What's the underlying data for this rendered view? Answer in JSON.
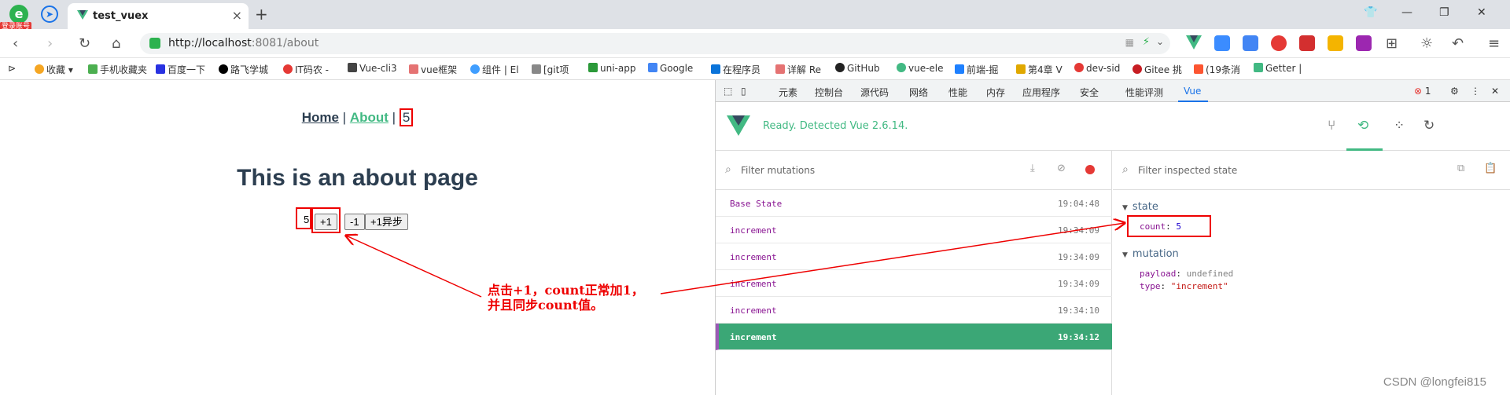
{
  "browser": {
    "login_badge": "登录账号",
    "tab_title": "test_vuex",
    "url_host": "http://localhost",
    "url_rest": ":8081/about"
  },
  "bookmarks": [
    {
      "label": "收藏",
      "color": "#f5a623"
    },
    {
      "label": "手机收藏夹",
      "color": "#4caf50"
    },
    {
      "label": "百度一下",
      "color": "#2932e1"
    },
    {
      "label": "路飞学城",
      "color": "#000000"
    },
    {
      "label": "IT码农 -",
      "color": "#e53935"
    },
    {
      "label": "Vue-cli3",
      "color": "#444444"
    },
    {
      "label": "vue框架",
      "color": "#e57373"
    },
    {
      "label": "组件 | El",
      "color": "#409eff"
    },
    {
      "label": "[git项",
      "color": "#888888"
    },
    {
      "label": "uni-app",
      "color": "#2b9939"
    },
    {
      "label": "Google",
      "color": "#4285f4"
    },
    {
      "label": "在程序员",
      "color": "#0a74da"
    },
    {
      "label": "详解 Re",
      "color": "#e57373"
    },
    {
      "label": "GitHub",
      "color": "#222222"
    },
    {
      "label": "vue-ele",
      "color": "#42b983"
    },
    {
      "label": "前端-掘",
      "color": "#1e80ff"
    },
    {
      "label": "第4章 V",
      "color": "#e0a800"
    },
    {
      "label": "dev-sid",
      "color": "#e53935"
    },
    {
      "label": "Gitee 挑",
      "color": "#c71d23"
    },
    {
      "label": "(19条消",
      "color": "#fc5531"
    },
    {
      "label": "Getter |",
      "color": "#42b983"
    }
  ],
  "page": {
    "nav_home": "Home",
    "nav_sep1": "|",
    "nav_about": "About",
    "nav_sep2": "|",
    "nav_count": "5",
    "heading": "This is an about page",
    "count": "5",
    "btn_inc": "+1",
    "btn_dec": "-1",
    "btn_async": "+1异步",
    "annotation": "点击+1，count正常加1，并且同步count值。"
  },
  "devtools": {
    "tabs": [
      "元素",
      "控制台",
      "源代码",
      "网络",
      "性能",
      "内存",
      "应用程序",
      "安全",
      "性能评测",
      "Vue"
    ],
    "active_tab": "Vue",
    "error_count": "1",
    "ready_text": "Ready. Detected Vue 2.6.14.",
    "mutation_filter_placeholder": "Filter mutations",
    "state_filter_placeholder": "Filter inspected state",
    "mutations": [
      {
        "name": "Base State",
        "time": "19:04:48"
      },
      {
        "name": "increment",
        "time": "19:34:09"
      },
      {
        "name": "increment",
        "time": "19:34:09"
      },
      {
        "name": "increment",
        "time": "19:34:09"
      },
      {
        "name": "increment",
        "time": "19:34:10"
      },
      {
        "name": "increment",
        "time": "19:34:12",
        "selected": true
      }
    ],
    "state_section": "state",
    "state_key": "count",
    "state_value": "5",
    "mutation_section": "mutation",
    "payload_key": "payload",
    "payload_value": "undefined",
    "type_key": "type",
    "type_value": "\"increment\""
  },
  "watermark": "CSDN @longfei815",
  "colors": {
    "vue_green": "#42b983",
    "annotation_red": "#ee0000",
    "selected_row": "#3ba776"
  }
}
